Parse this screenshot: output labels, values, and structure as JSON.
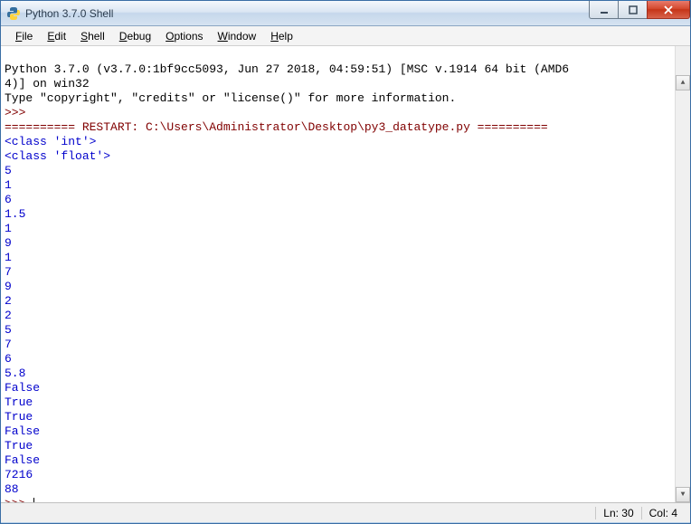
{
  "window": {
    "title": "Python 3.7.0 Shell"
  },
  "menu": {
    "file": "File",
    "edit": "Edit",
    "shell": "Shell",
    "debug": "Debug",
    "options": "Options",
    "window": "Window",
    "help": "Help"
  },
  "shell": {
    "banner1": "Python 3.7.0 (v3.7.0:1bf9cc5093, Jun 27 2018, 04:59:51) [MSC v.1914 64 bit (AMD6",
    "banner2": "4)] on win32",
    "banner3": "Type \"copyright\", \"credits\" or \"license()\" for more information.",
    "prompt": ">>> ",
    "restart": "========== RESTART: C:\\Users\\Administrator\\Desktop\\py3_datatype.py ==========",
    "out": [
      "<class 'int'>",
      "<class 'float'>",
      "5",
      "1",
      "6",
      "1.5",
      "1",
      "9",
      "1",
      "7",
      "9",
      "2",
      "2",
      "5",
      "7",
      "6",
      "5.8",
      "False",
      "True",
      "True",
      "False",
      "True",
      "False",
      "7216",
      "88"
    ]
  },
  "status": {
    "ln": "Ln: 30",
    "col": "Col: 4"
  }
}
